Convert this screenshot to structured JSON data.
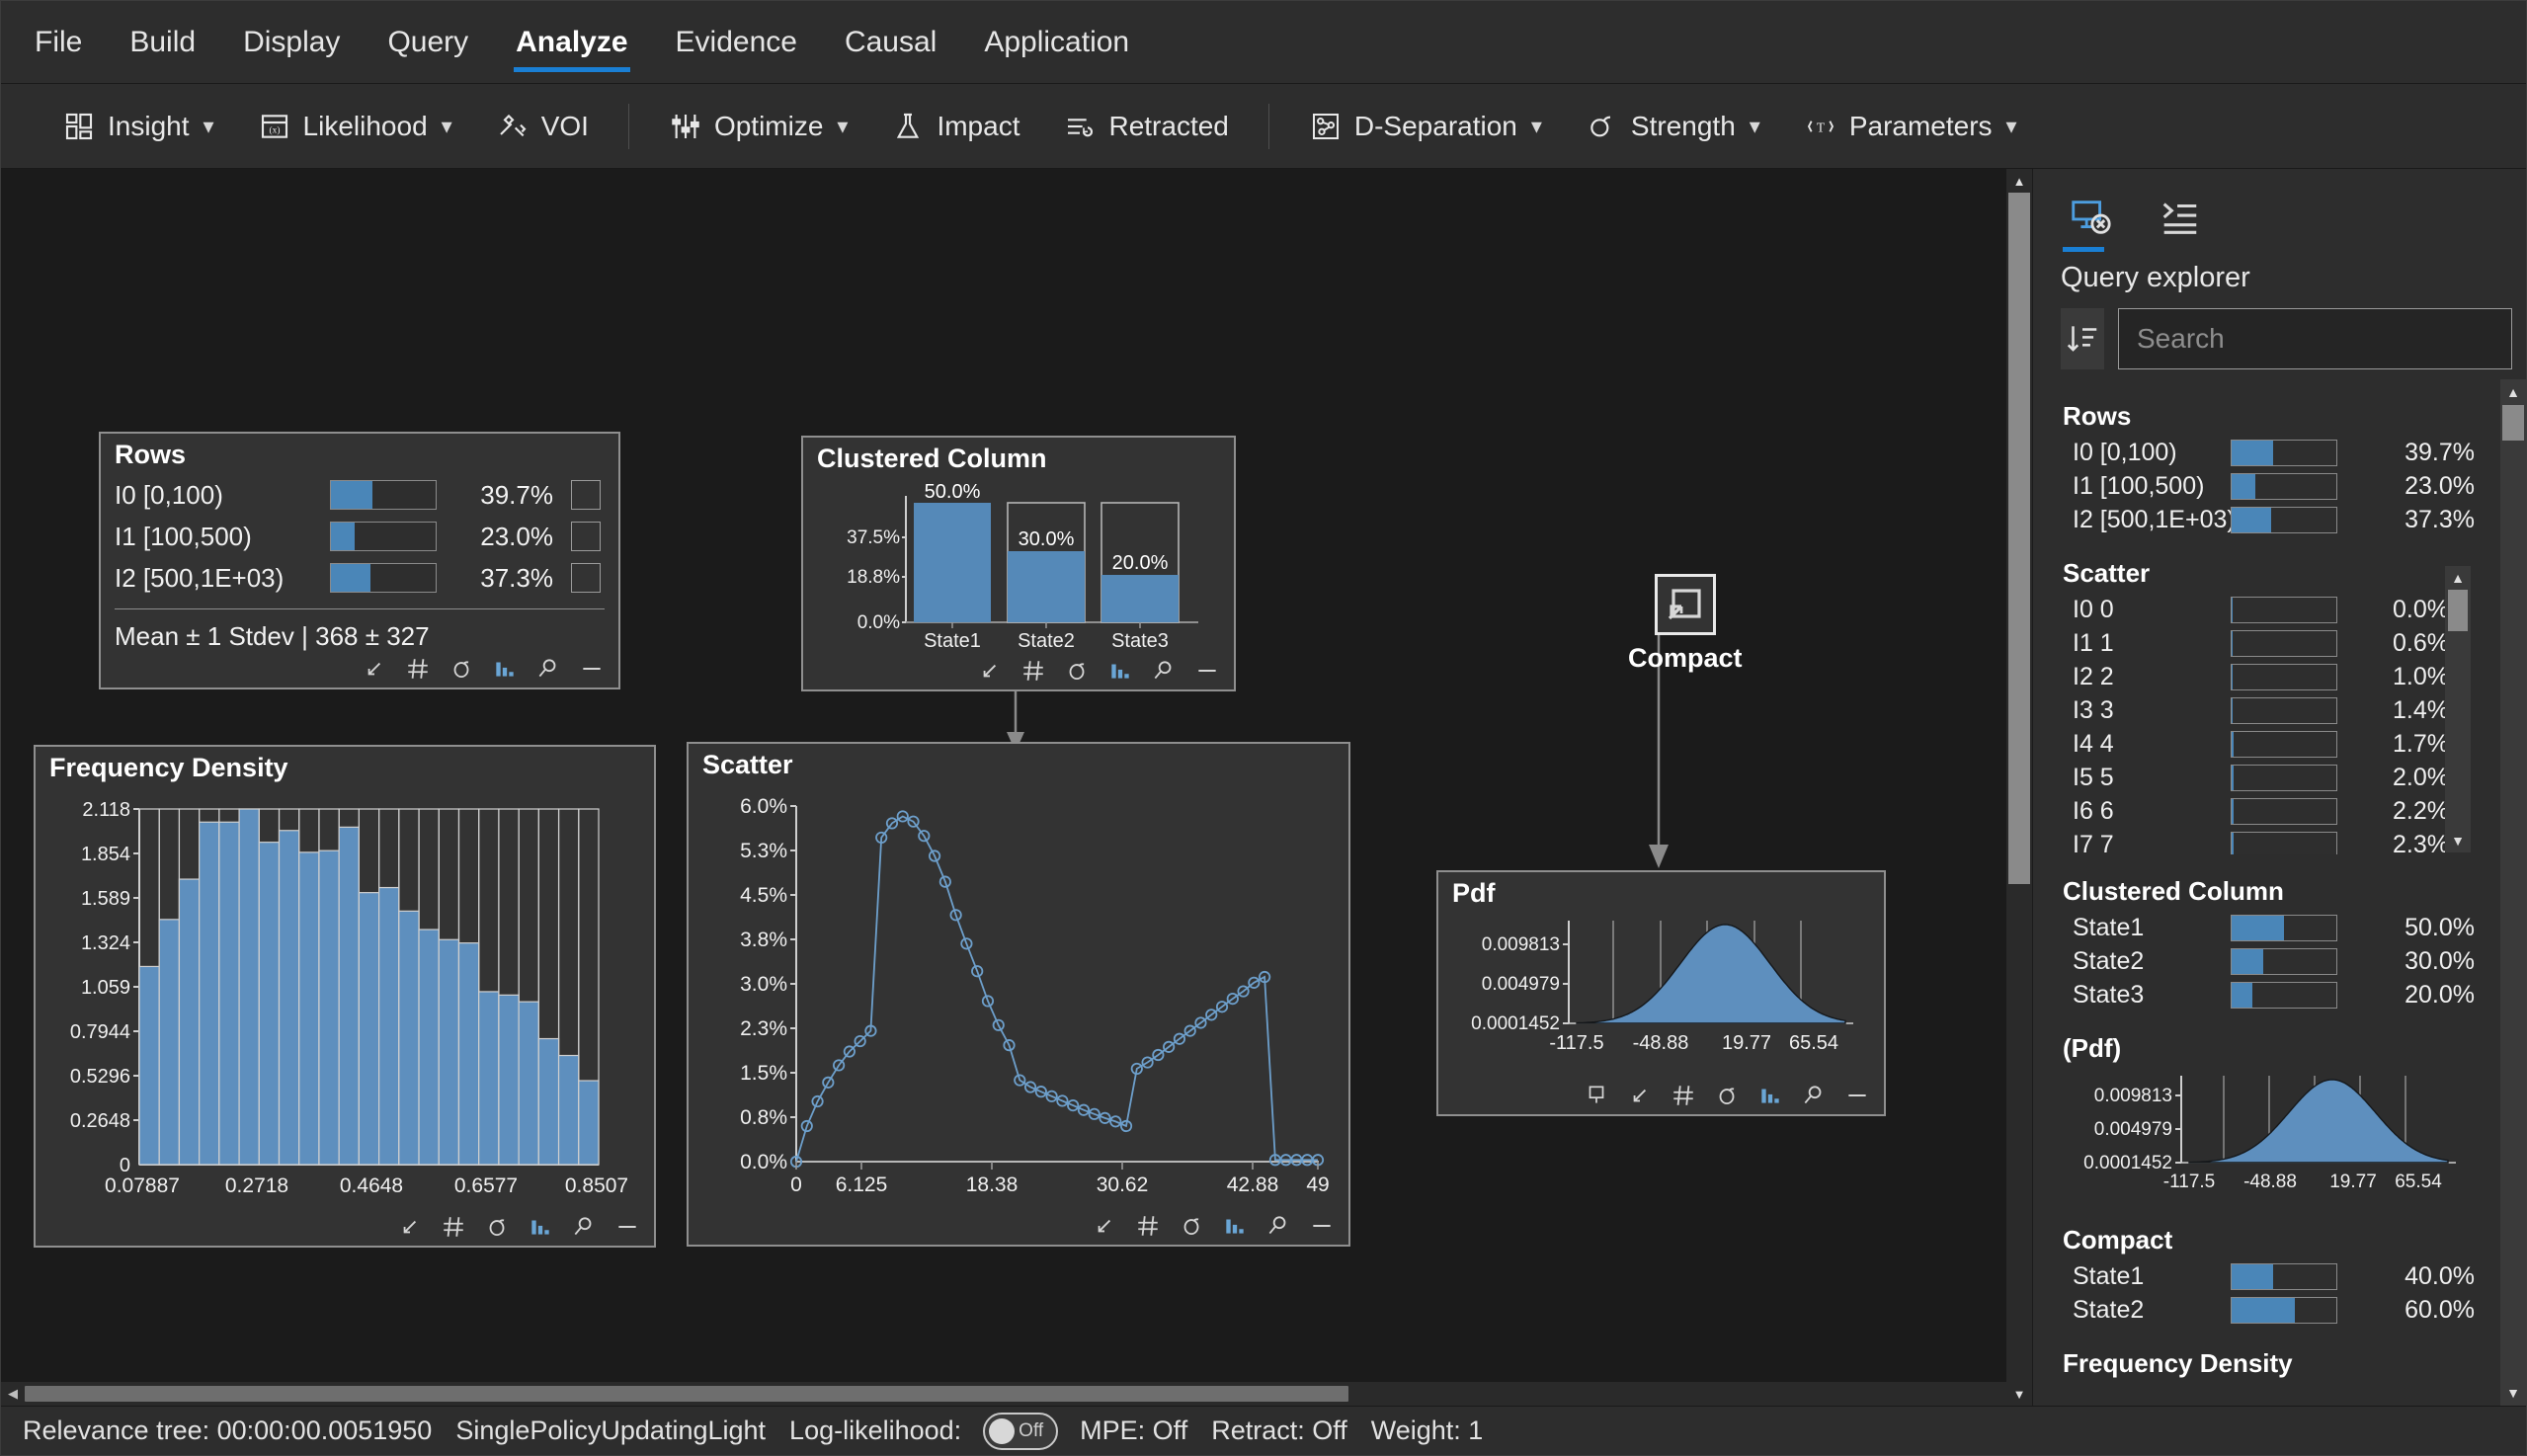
{
  "menu": {
    "items": [
      {
        "label": "File",
        "active": false
      },
      {
        "label": "Build",
        "active": false
      },
      {
        "label": "Display",
        "active": false
      },
      {
        "label": "Query",
        "active": false
      },
      {
        "label": "Analyze",
        "active": true
      },
      {
        "label": "Evidence",
        "active": false
      },
      {
        "label": "Causal",
        "active": false
      },
      {
        "label": "Application",
        "active": false
      }
    ]
  },
  "ribbon": {
    "items": [
      {
        "label": "Insight",
        "icon": "insight-icon",
        "caret": true
      },
      {
        "label": "Likelihood",
        "icon": "likelihood-icon",
        "caret": true
      },
      {
        "label": "VOI",
        "icon": "voi-icon",
        "caret": false
      },
      {
        "label": "Optimize",
        "icon": "optimize-icon",
        "caret": true
      },
      {
        "label": "Impact",
        "icon": "impact-icon",
        "caret": false
      },
      {
        "label": "Retracted",
        "icon": "retracted-icon",
        "caret": false
      },
      {
        "label": "D-Separation",
        "icon": "d-separation-icon",
        "caret": true
      },
      {
        "label": "Strength",
        "icon": "strength-icon",
        "caret": true
      },
      {
        "label": "Parameters",
        "icon": "parameters-icon",
        "caret": true
      }
    ]
  },
  "canvas": {
    "nodes": {
      "rows": {
        "title": "Rows",
        "states": [
          {
            "name": "I0 [0,100)",
            "pct": "39.7%",
            "value": 39.7
          },
          {
            "name": "I1 [100,500)",
            "pct": "23.0%",
            "value": 23.0
          },
          {
            "name": "I2 [500,1E+03)",
            "pct": "37.3%",
            "value": 37.3
          }
        ],
        "summary": "Mean ± 1 Stdev | 368 ± 327"
      },
      "clustered_column": {
        "title": "Clustered Column"
      },
      "frequency_density": {
        "title": "Frequency Density"
      },
      "scatter": {
        "title": "Scatter"
      },
      "compact": {
        "title": "Compact"
      },
      "pdf": {
        "title": "Pdf"
      }
    },
    "node_tools": [
      "collapse-icon",
      "grid-icon",
      "sigma-icon",
      "bar-chart-icon",
      "magnifier-icon",
      "minimize-icon"
    ],
    "pdf_node_tools": [
      "pin-icon",
      "collapse-icon",
      "grid-icon",
      "sigma-icon",
      "bar-chart-icon",
      "magnifier-icon",
      "minimize-icon"
    ]
  },
  "chart_data": [
    {
      "type": "bar",
      "name": "Clustered Column",
      "title": "Clustered Column",
      "categories": [
        "State1",
        "State2",
        "State3"
      ],
      "values": [
        50.0,
        30.0,
        20.0
      ],
      "data_labels": [
        "50.0%",
        "30.0%",
        "20.0%"
      ],
      "ytick_labels": [
        "0.0%",
        "18.8%",
        "37.5%"
      ],
      "ylim": [
        0,
        50
      ],
      "xlabel": "",
      "ylabel": "",
      "grid": false,
      "legend": "none"
    },
    {
      "type": "bar",
      "name": "Frequency Density",
      "title": "Frequency Density",
      "ytick_labels": [
        "0",
        "0.2648",
        "0.5296",
        "0.7944",
        "1.059",
        "1.324",
        "1.589",
        "1.854",
        "2.118"
      ],
      "ytick_values": [
        0,
        0.2648,
        0.5296,
        0.7944,
        1.059,
        1.324,
        1.589,
        1.854,
        2.118
      ],
      "xtick_labels": [
        "0.07887",
        "0.2718",
        "0.4648",
        "0.6577",
        "0.8507"
      ],
      "xtick_values": [
        0.07887,
        0.2718,
        0.4648,
        0.6577,
        0.8507
      ],
      "ylim": [
        0,
        2.118
      ],
      "xlim": [
        0.07887,
        0.8507
      ],
      "values": [
        1.18,
        1.46,
        1.7,
        2.04,
        2.04,
        2.118,
        1.92,
        1.99,
        1.86,
        1.87,
        2.01,
        1.62,
        1.65,
        1.51,
        1.4,
        1.34,
        1.32,
        1.03,
        1.01,
        0.97,
        0.75,
        0.65,
        0.5
      ],
      "grid": true,
      "legend": "none"
    },
    {
      "type": "line",
      "name": "Scatter",
      "title": "Scatter",
      "markers": true,
      "ytick_labels": [
        "0.0%",
        "0.8%",
        "1.5%",
        "2.3%",
        "3.0%",
        "3.8%",
        "4.5%",
        "5.3%",
        "6.0%"
      ],
      "ytick_values": [
        0.0,
        0.8,
        1.5,
        2.3,
        3.0,
        3.8,
        4.5,
        5.3,
        6.0
      ],
      "xtick_labels": [
        "0",
        "6.125",
        "18.38",
        "30.62",
        "42.88",
        "49"
      ],
      "xtick_values": [
        0,
        6.125,
        18.38,
        30.62,
        42.88,
        49
      ],
      "ylim": [
        0,
        6.2
      ],
      "xlim": [
        0,
        49
      ],
      "x": [
        0,
        1,
        2,
        3,
        4,
        5,
        6,
        7,
        8,
        9,
        10,
        11,
        12,
        13,
        14,
        15,
        16,
        17,
        18,
        19,
        20,
        21,
        22,
        23,
        24,
        25,
        26,
        27,
        28,
        29,
        30,
        31,
        32,
        33,
        34,
        35,
        36,
        37,
        38,
        39,
        40,
        41,
        42,
        43,
        44,
        45,
        46,
        47,
        48,
        49
      ],
      "y": [
        0.0,
        0.62,
        1.05,
        1.38,
        1.68,
        1.92,
        2.1,
        2.28,
        5.65,
        5.9,
        6.02,
        5.93,
        5.68,
        5.33,
        4.88,
        4.3,
        3.8,
        3.32,
        2.8,
        2.38,
        2.03,
        1.42,
        1.3,
        1.22,
        1.14,
        1.06,
        0.98,
        0.9,
        0.83,
        0.76,
        0.7,
        0.62,
        1.62,
        1.73,
        1.86,
        2.0,
        2.14,
        2.28,
        2.42,
        2.56,
        2.7,
        2.84,
        2.97,
        3.12,
        3.22,
        0.03,
        0.03,
        0.03,
        0.03,
        0.03
      ],
      "grid": false,
      "legend": "none"
    },
    {
      "type": "area",
      "name": "Pdf",
      "title": "Pdf",
      "ytick_labels": [
        "0.0001452",
        "0.004979",
        "0.009813"
      ],
      "ytick_values": [
        0.0001452,
        0.004979,
        0.009813
      ],
      "xtick_labels": [
        "-117.5",
        "-48.88",
        "19.77",
        "65.54"
      ],
      "xtick_values": [
        -117.5,
        -48.88,
        19.77,
        65.54
      ],
      "ylim": [
        0.0001452,
        0.0106
      ],
      "xlim": [
        -140,
        88
      ],
      "distribution": "normal",
      "mean": -14.0,
      "stdev": 38.0,
      "grid": true,
      "legend": "none"
    }
  ],
  "sidebar": {
    "tabs": [
      {
        "icon": "query-monitor-icon",
        "active": true
      },
      {
        "icon": "script-list-icon",
        "active": false
      }
    ],
    "heading": "Query explorer",
    "sort_icon": "sort-descending-icon",
    "search": {
      "value": "",
      "placeholder": "Search"
    },
    "groups": [
      {
        "title": "Rows",
        "rows": [
          {
            "name": "I0 [0,100)",
            "pct": "39.7%",
            "value": 39.7
          },
          {
            "name": "I1 [100,500)",
            "pct": "23.0%",
            "value": 23.0
          },
          {
            "name": "I2 [500,1E+03)",
            "pct": "37.3%",
            "value": 37.3
          }
        ]
      },
      {
        "title": "Scatter",
        "scroll": true,
        "rows": [
          {
            "name": "I0 0",
            "pct": "0.0%",
            "value": 0.0
          },
          {
            "name": "I1 1",
            "pct": "0.6%",
            "value": 0.6
          },
          {
            "name": "I2 2",
            "pct": "1.0%",
            "value": 1.0
          },
          {
            "name": "I3 3",
            "pct": "1.4%",
            "value": 1.4
          },
          {
            "name": "I4 4",
            "pct": "1.7%",
            "value": 1.7
          },
          {
            "name": "I5 5",
            "pct": "2.0%",
            "value": 2.0
          },
          {
            "name": "I6 6",
            "pct": "2.2%",
            "value": 2.2
          },
          {
            "name": "I7 7",
            "pct": "2.3%",
            "value": 2.3
          }
        ]
      },
      {
        "title": "Clustered Column",
        "rows": [
          {
            "name": "State1",
            "pct": "50.0%",
            "value": 50.0
          },
          {
            "name": "State2",
            "pct": "30.0%",
            "value": 30.0
          },
          {
            "name": "State3",
            "pct": "20.0%",
            "value": 20.0
          }
        ]
      },
      {
        "title": "(Pdf)",
        "chart": "pdf"
      },
      {
        "title": "Compact",
        "rows": [
          {
            "name": "State1",
            "pct": "40.0%",
            "value": 40.0
          },
          {
            "name": "State2",
            "pct": "60.0%",
            "value": 60.0
          }
        ]
      },
      {
        "title": "Frequency Density"
      }
    ]
  },
  "statusbar": {
    "relevance_tree": "Relevance tree: 00:00:00.0051950",
    "algorithm": "SinglePolicyUpdatingLight",
    "loglikelihood_label": "Log-likelihood:",
    "loglikelihood_toggle": "Off",
    "mpe": "MPE: Off",
    "retract": "Retract: Off",
    "weight": "Weight: 1"
  },
  "colors": {
    "accent": "#1a7fd4",
    "bar": "#4a86b8",
    "panel": "#333333",
    "chrome": "#2d2d2d",
    "canvas": "#1b1b1b"
  }
}
